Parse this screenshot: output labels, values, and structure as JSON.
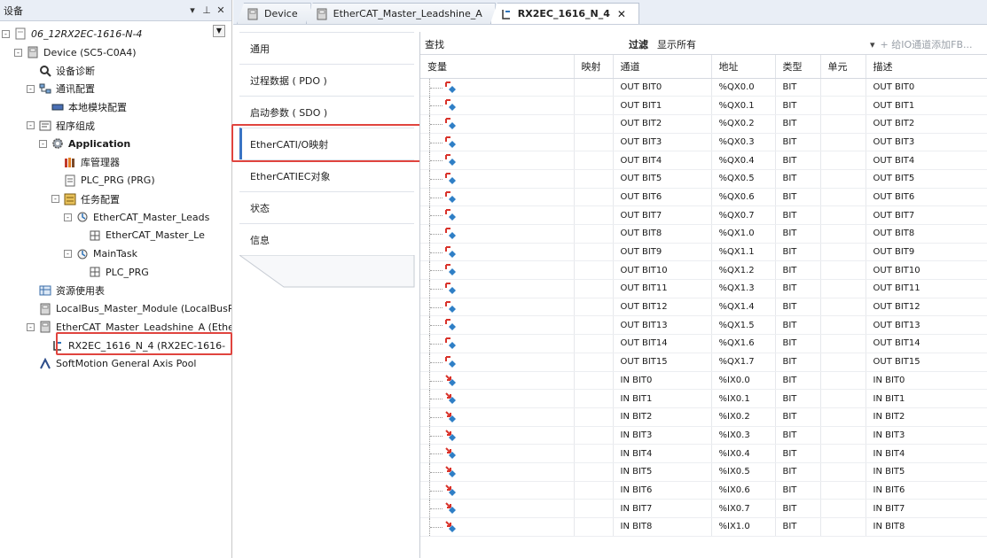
{
  "left_panel": {
    "title": "设备",
    "header_buttons": [
      "▾",
      "⊥",
      "✕"
    ],
    "tree": [
      {
        "label": "06_12RX2EC-1616-N-4",
        "italic": true,
        "icon": "project-icon",
        "exp": "-",
        "level": 0
      },
      {
        "label": "Device (SC5-C0A4)",
        "icon": "device-icon",
        "exp": "-",
        "level": 1
      },
      {
        "label": "设备诊断",
        "icon": "diagnosis-icon",
        "exp": "",
        "level": 2
      },
      {
        "label": "通讯配置",
        "icon": "communication-icon",
        "exp": "-",
        "level": 2
      },
      {
        "label": "本地模块配置",
        "icon": "local-module-icon",
        "exp": "",
        "level": 3
      },
      {
        "label": "程序组成",
        "icon": "program-icon",
        "exp": "-",
        "level": 2
      },
      {
        "label": "Application",
        "bold": true,
        "icon": "gear-icon",
        "exp": "-",
        "level": 3
      },
      {
        "label": "库管理器",
        "icon": "library-icon",
        "exp": "",
        "level": 4
      },
      {
        "label": "PLC_PRG (PRG)",
        "icon": "pou-icon",
        "exp": "",
        "level": 4
      },
      {
        "label": "任务配置",
        "icon": "task-config-icon",
        "exp": "-",
        "level": 4
      },
      {
        "label": "EtherCAT_Master_Leads",
        "icon": "task-icon",
        "exp": "-",
        "level": 5
      },
      {
        "label": "EtherCAT_Master_Le",
        "icon": "task-call-icon",
        "exp": "",
        "level": 6
      },
      {
        "label": "MainTask",
        "icon": "task-icon",
        "exp": "-",
        "level": 5
      },
      {
        "label": "PLC_PRG",
        "icon": "task-call-icon",
        "exp": "",
        "level": 6
      },
      {
        "label": "资源使用表",
        "icon": "resource-table-icon",
        "exp": "",
        "level": 2
      },
      {
        "label": "LocalBus_Master_Module (LocalBusR:",
        "icon": "module-icon",
        "exp": "",
        "level": 2
      },
      {
        "label": "EtherCAT_Master_Leadshine_A (Ethe",
        "icon": "module-icon",
        "exp": "-",
        "level": 2
      },
      {
        "label": "RX2EC_1616_N_4 (RX2EC-1616-",
        "icon": "slave-icon",
        "exp": "",
        "level": 3
      },
      {
        "label": "SoftMotion General Axis Pool",
        "icon": "axis-pool-icon",
        "exp": "",
        "level": 2
      }
    ]
  },
  "tabs": [
    {
      "label": "Device",
      "active": false,
      "close": ""
    },
    {
      "label": "EtherCAT_Master_Leadshine_A",
      "active": false,
      "close": ""
    },
    {
      "label": "RX2EC_1616_N_4",
      "active": true,
      "close": "✕"
    }
  ],
  "categories": [
    {
      "label": "通用",
      "active": false
    },
    {
      "label": "过程数据 ( PDO )",
      "active": false
    },
    {
      "label": "启动参数 ( SDO )",
      "active": false
    },
    {
      "label": "EtherCATI/O映射",
      "active": true
    },
    {
      "label": "EtherCATIEC对象",
      "active": false
    },
    {
      "label": "状态",
      "active": false
    },
    {
      "label": "信息",
      "active": false
    }
  ],
  "toolbar": {
    "find_label": "查找",
    "filter_label": "过滤",
    "filter_value": "显示所有",
    "add_fb_label": "给IO通道添加FB...",
    "add_fb_dropdown": "▾",
    "add_fb_icon": "+"
  },
  "columns": [
    "变量",
    "映射",
    "通道",
    "地址",
    "类型",
    "单元",
    "描述"
  ],
  "rows": [
    {
      "dir": "out",
      "variable": "",
      "mapping": "",
      "channel": "OUT BIT0",
      "address": "%QX0.0",
      "type": "BIT",
      "unit": "",
      "description": "OUT BIT0"
    },
    {
      "dir": "out",
      "variable": "",
      "mapping": "",
      "channel": "OUT BIT1",
      "address": "%QX0.1",
      "type": "BIT",
      "unit": "",
      "description": "OUT BIT1"
    },
    {
      "dir": "out",
      "variable": "",
      "mapping": "",
      "channel": "OUT BIT2",
      "address": "%QX0.2",
      "type": "BIT",
      "unit": "",
      "description": "OUT BIT2"
    },
    {
      "dir": "out",
      "variable": "",
      "mapping": "",
      "channel": "OUT BIT3",
      "address": "%QX0.3",
      "type": "BIT",
      "unit": "",
      "description": "OUT BIT3"
    },
    {
      "dir": "out",
      "variable": "",
      "mapping": "",
      "channel": "OUT BIT4",
      "address": "%QX0.4",
      "type": "BIT",
      "unit": "",
      "description": "OUT BIT4"
    },
    {
      "dir": "out",
      "variable": "",
      "mapping": "",
      "channel": "OUT BIT5",
      "address": "%QX0.5",
      "type": "BIT",
      "unit": "",
      "description": "OUT BIT5"
    },
    {
      "dir": "out",
      "variable": "",
      "mapping": "",
      "channel": "OUT BIT6",
      "address": "%QX0.6",
      "type": "BIT",
      "unit": "",
      "description": "OUT BIT6"
    },
    {
      "dir": "out",
      "variable": "",
      "mapping": "",
      "channel": "OUT BIT7",
      "address": "%QX0.7",
      "type": "BIT",
      "unit": "",
      "description": "OUT BIT7"
    },
    {
      "dir": "out",
      "variable": "",
      "mapping": "",
      "channel": "OUT BIT8",
      "address": "%QX1.0",
      "type": "BIT",
      "unit": "",
      "description": "OUT BIT8"
    },
    {
      "dir": "out",
      "variable": "",
      "mapping": "",
      "channel": "OUT BIT9",
      "address": "%QX1.1",
      "type": "BIT",
      "unit": "",
      "description": "OUT BIT9"
    },
    {
      "dir": "out",
      "variable": "",
      "mapping": "",
      "channel": "OUT BIT10",
      "address": "%QX1.2",
      "type": "BIT",
      "unit": "",
      "description": "OUT BIT10"
    },
    {
      "dir": "out",
      "variable": "",
      "mapping": "",
      "channel": "OUT BIT11",
      "address": "%QX1.3",
      "type": "BIT",
      "unit": "",
      "description": "OUT BIT11"
    },
    {
      "dir": "out",
      "variable": "",
      "mapping": "",
      "channel": "OUT BIT12",
      "address": "%QX1.4",
      "type": "BIT",
      "unit": "",
      "description": "OUT BIT12"
    },
    {
      "dir": "out",
      "variable": "",
      "mapping": "",
      "channel": "OUT BIT13",
      "address": "%QX1.5",
      "type": "BIT",
      "unit": "",
      "description": "OUT BIT13"
    },
    {
      "dir": "out",
      "variable": "",
      "mapping": "",
      "channel": "OUT BIT14",
      "address": "%QX1.6",
      "type": "BIT",
      "unit": "",
      "description": "OUT BIT14"
    },
    {
      "dir": "out",
      "variable": "",
      "mapping": "",
      "channel": "OUT BIT15",
      "address": "%QX1.7",
      "type": "BIT",
      "unit": "",
      "description": "OUT BIT15"
    },
    {
      "dir": "in",
      "variable": "",
      "mapping": "",
      "channel": "IN BIT0",
      "address": "%IX0.0",
      "type": "BIT",
      "unit": "",
      "description": "IN BIT0"
    },
    {
      "dir": "in",
      "variable": "",
      "mapping": "",
      "channel": "IN BIT1",
      "address": "%IX0.1",
      "type": "BIT",
      "unit": "",
      "description": "IN BIT1"
    },
    {
      "dir": "in",
      "variable": "",
      "mapping": "",
      "channel": "IN BIT2",
      "address": "%IX0.2",
      "type": "BIT",
      "unit": "",
      "description": "IN BIT2"
    },
    {
      "dir": "in",
      "variable": "",
      "mapping": "",
      "channel": "IN BIT3",
      "address": "%IX0.3",
      "type": "BIT",
      "unit": "",
      "description": "IN BIT3"
    },
    {
      "dir": "in",
      "variable": "",
      "mapping": "",
      "channel": "IN BIT4",
      "address": "%IX0.4",
      "type": "BIT",
      "unit": "",
      "description": "IN BIT4"
    },
    {
      "dir": "in",
      "variable": "",
      "mapping": "",
      "channel": "IN BIT5",
      "address": "%IX0.5",
      "type": "BIT",
      "unit": "",
      "description": "IN BIT5"
    },
    {
      "dir": "in",
      "variable": "",
      "mapping": "",
      "channel": "IN BIT6",
      "address": "%IX0.6",
      "type": "BIT",
      "unit": "",
      "description": "IN BIT6"
    },
    {
      "dir": "in",
      "variable": "",
      "mapping": "",
      "channel": "IN BIT7",
      "address": "%IX0.7",
      "type": "BIT",
      "unit": "",
      "description": "IN BIT7"
    },
    {
      "dir": "in",
      "variable": "",
      "mapping": "",
      "channel": "IN BIT8",
      "address": "%IX1.0",
      "type": "BIT",
      "unit": "",
      "description": "IN BIT8"
    }
  ],
  "colors": {
    "highlight_red": "#e0443e",
    "header_bg": "#e9eef6",
    "active_tab_accent": "#3a74c4",
    "output_arrow": "#d9332b",
    "input_arrow": "#d9332b",
    "io_diamond": "#2f7fc6"
  }
}
